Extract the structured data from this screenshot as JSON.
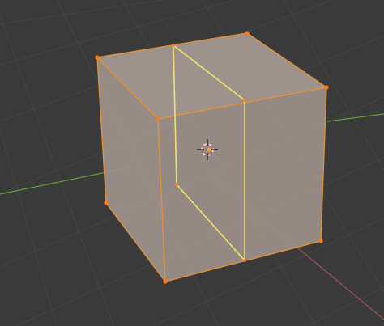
{
  "viewport": {
    "mode": "edit-mode",
    "selection": "all-faces"
  },
  "colors": {
    "background": "#3a3a3a",
    "grid_line": "#444444",
    "axis_x": "#a0525a",
    "axis_y": "#6a9a3a",
    "face_fill": "#a0938d",
    "face_side": "#9a8d87",
    "edge_selected": "#e0913a",
    "loop_cut": "#f0e36a",
    "vertex": "#ff7a1a",
    "cursor_ring": "#e6e6e6",
    "cursor_accent": "#e05050"
  },
  "icons": {
    "cursor": "3d-cursor-icon"
  }
}
